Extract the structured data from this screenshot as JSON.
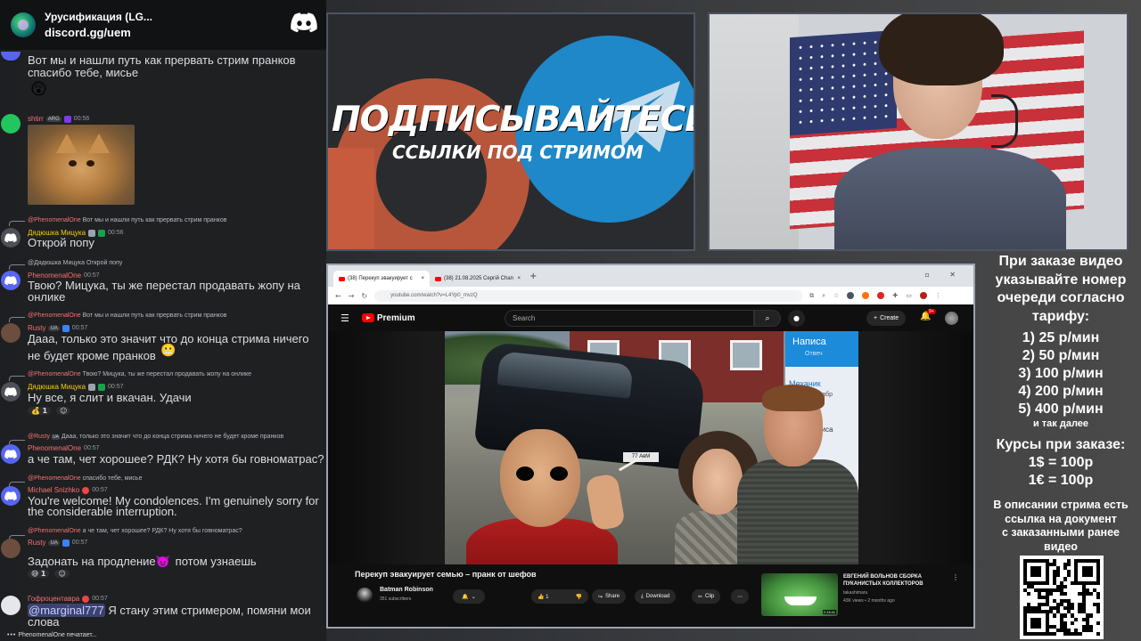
{
  "chat": {
    "server_name": "Урусификация (LG...",
    "server_link": "discord.gg/uem",
    "messages": {
      "m1_text_1": "Вот мы и нашли путь как прервать стрим пранков",
      "m1_text_2": "спасибо тебе, мисье",
      "m2_author": "shtirr",
      "m2_tag": "ARG",
      "m2_time": "00:56",
      "m3_reply_name": "@PhenomenalOne",
      "m3_reply_text": "Вот мы и нашли путь как прервать стрим пранков",
      "m3_author": "Дядюшка Мицука",
      "m3_time": "00:56",
      "m3_text": "Открой попу",
      "m4_reply_name": "@Дядюшка Мицука",
      "m4_reply_text": "Открой попу",
      "m4_author": "PhenomenalOne",
      "m4_time": "00:57",
      "m4_text_1": "Твою? Мицука, ты же перестал продавать жопу на",
      "m4_text_2": "онлике",
      "m5_reply_name": "@PhenomenalOne",
      "m5_reply_text": "Вот мы и нашли путь как прервать стрим пранков",
      "m5_author": "Rusty",
      "m5_tag": "UA",
      "m5_time": "00:57",
      "m5_text_1": "Дааа, только это значит что до конца стрима ничего",
      "m5_text_2": "не будет кроме пранков",
      "m6_reply_name": "@PhenomenalOne",
      "m6_reply_text": "Твою? Мицука, ты же перестал продавать жопу на онлике",
      "m6_author": "Дядюшка Мицука",
      "m6_time": "00:57",
      "m6_text": "Ну все, я слит и вкачан. Удачи",
      "m6_reaction_count": "1",
      "m7_reply_name": "@Rusty",
      "m7_reply_tag": "UA",
      "m7_reply_text": "Дааа, только это значит что до конца стрима ничего не будет кроме пранков",
      "m7_author": "PhenomenalOne",
      "m7_time": "00:57",
      "m7_text": "а че там, чет хорошее? РДК? Ну хотя бы говноматрас?",
      "m8_reply_name": "@PhenomenalOne",
      "m8_reply_text": "спасибо тебе, мисье",
      "m8_author": "Michael Snizhko",
      "m8_time": "00:57",
      "m8_text_1": "You're welcome! My condolences. I'm genuinely sorry for",
      "m8_text_2": "the considerable interruption.",
      "m9_reply_name": "@PhenomenalOne",
      "m9_reply_text": "а че там, чет хорошее? РДК? Ну хотя бы говноматрас?",
      "m9_author": "Rusty",
      "m9_tag": "UA",
      "m9_time": "00:57",
      "m9_text_a": "Задонать на продление",
      "m9_text_b": "потом узнаешь",
      "m9_reaction_count": "1",
      "m10_author": "Гофроцентавра",
      "m10_time": "00:57",
      "m10_mention": "@marginal777",
      "m10_text_1": " Я стану этим стримером, помяни мои",
      "m10_text_2": "слова"
    },
    "typing": "PhenomenalOne печатает..."
  },
  "banner": {
    "title": "ПОДПИСЫВАЙТЕСЬ",
    "subtitle": "ССЫЛКИ ПОД СТРИМОМ"
  },
  "browser": {
    "tab1": "(38) Перекуп эвакуирует с",
    "tab2": "(38) 21.08.2025 Сергiй Chan",
    "url": "youtube.com/watch?v=L4Yp0_mvzQ",
    "yt_logo": "Premium",
    "search_placeholder": "Search",
    "create_label": "Create",
    "bell_badge": "9+",
    "thumb_plate": "77 АвМ",
    "thumb_ui_title": "Написа",
    "thumb_ui_sub": "Отвеч",
    "thumb_ui_mech": "Механик",
    "thumb_ui_mech2": "вито с декабр",
    "thumb_ui_btn": "Написа",
    "video_title": "Перекуп эвакуирует семью – пранк от шефов",
    "channel_name": "Batman Robinson",
    "channel_subs": "351 subscribers",
    "like_count": "1",
    "share_label": "Share",
    "download_label": "Download",
    "clip_label": "Clip",
    "rec_title": "ЕВГЕНИЙ ВОЛЬНОВ СБОРКА ПУКАНИСТЫХ КОЛЛЕКТОРОВ",
    "rec_channel": "takashimaru",
    "rec_meta": "43K views • 2 months ago",
    "rec_duration": "2:13:41"
  },
  "pricing": {
    "head_1": "При заказе видео",
    "head_2": "указывайте номер",
    "head_3": "очереди согласно",
    "head_4": "тарифу:",
    "tiers": [
      "1) 25 р/мин",
      "2) 50 р/мин",
      "3) 100 р/мин",
      "4) 200 р/мин",
      "5) 400 р/мин"
    ],
    "etc": "и так далее",
    "rates_title": "Курсы при заказе:",
    "rate_usd": "1$ = 100р",
    "rate_eur": "1€ = 100р",
    "desc_1": "В описании стрима есть",
    "desc_2": "ссылка на документ",
    "desc_3": "с заказанными ранее",
    "desc_4": "видео"
  },
  "colors": {
    "discord_blurple": "#5865f2",
    "telegram_blue": "#1e88c8",
    "patreon_orange": "#c75b3d",
    "youtube_red": "#ff0000"
  }
}
